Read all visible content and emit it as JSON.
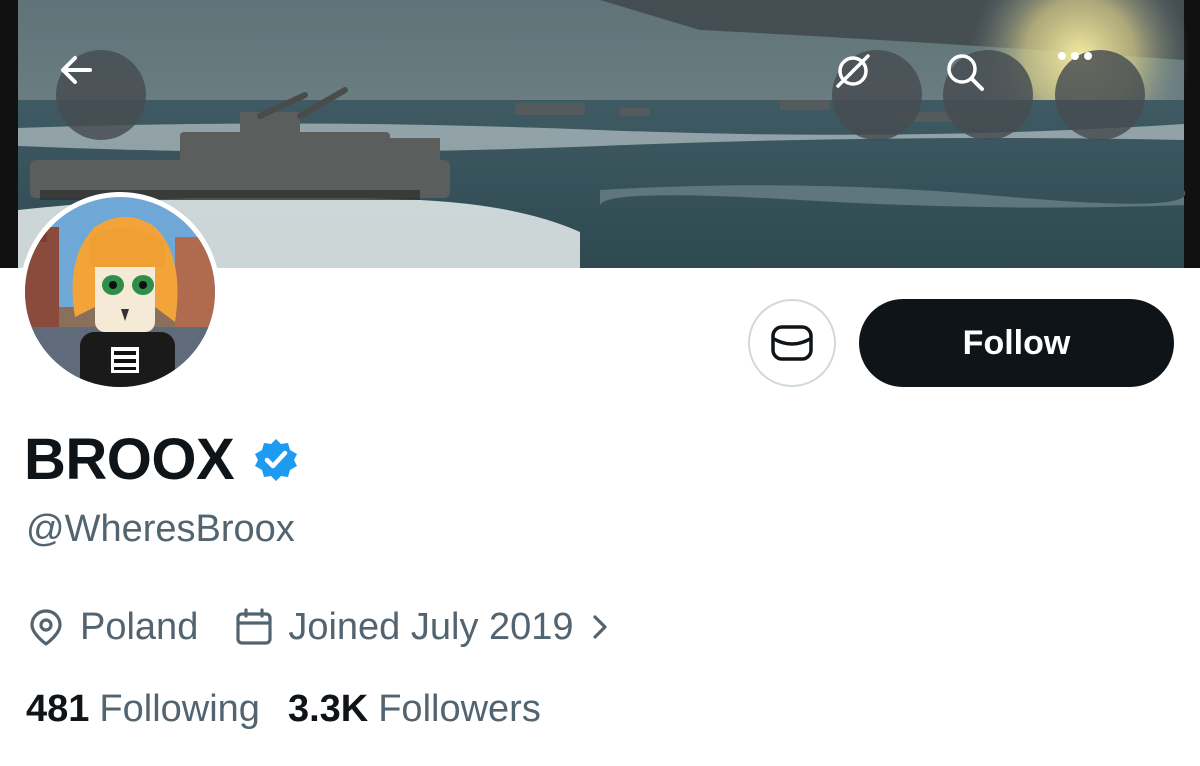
{
  "profile": {
    "display_name": "BROOX",
    "verified": true,
    "handle": "@WheresBroox",
    "location": "Poland",
    "joined": "Joined July 2019",
    "following_count": "481",
    "following_label": "Following",
    "followers_count": "3.3K",
    "followers_label": "Followers"
  },
  "actions": {
    "follow_label": "Follow"
  },
  "icons": {
    "back": "arrow-left-icon",
    "grok": "grok-icon",
    "search": "search-icon",
    "more": "more-dots-icon",
    "message": "envelope-icon",
    "location": "map-pin-icon",
    "calendar": "calendar-icon",
    "chevron": "chevron-right-icon",
    "verified": "verified-badge-icon"
  },
  "colors": {
    "verified_blue": "#1d9bf0",
    "follow_button_bg": "#0f1419",
    "secondary_text": "#536471"
  }
}
